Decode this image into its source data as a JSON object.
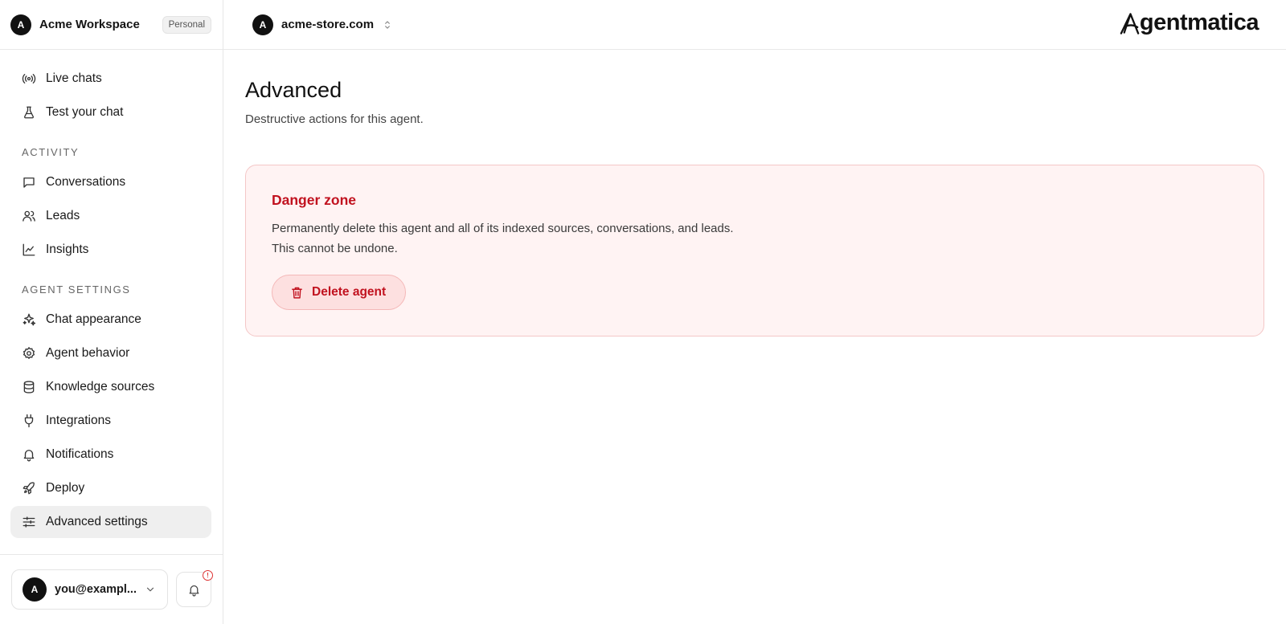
{
  "workspace": {
    "avatar_letter": "A",
    "name": "Acme Workspace",
    "badge": "Personal"
  },
  "nav": {
    "top_items": [
      {
        "label": "Live chats",
        "icon": "broadcast-icon"
      },
      {
        "label": "Test your chat",
        "icon": "flask-icon"
      }
    ],
    "sections": [
      {
        "title": "ACTIVITY",
        "items": [
          {
            "label": "Conversations",
            "icon": "message-square-icon"
          },
          {
            "label": "Leads",
            "icon": "users-icon"
          },
          {
            "label": "Insights",
            "icon": "line-chart-icon"
          }
        ]
      },
      {
        "title": "AGENT SETTINGS",
        "items": [
          {
            "label": "Chat appearance",
            "icon": "sparkles-icon"
          },
          {
            "label": "Agent behavior",
            "icon": "gear-icon"
          },
          {
            "label": "Knowledge sources",
            "icon": "database-icon"
          },
          {
            "label": "Integrations",
            "icon": "plug-icon"
          },
          {
            "label": "Notifications",
            "icon": "bell-icon"
          },
          {
            "label": "Deploy",
            "icon": "rocket-icon"
          },
          {
            "label": "Advanced settings",
            "icon": "sliders-icon",
            "active": true
          }
        ]
      }
    ]
  },
  "footer": {
    "avatar_letter": "A",
    "user_email": "you@exampl...",
    "alert_glyph": "!"
  },
  "topbar": {
    "site_avatar_letter": "A",
    "site_name": "acme-store.com",
    "logo_text": "gentmatica"
  },
  "main": {
    "title": "Advanced",
    "description": "Destructive actions for this agent.",
    "danger_zone": {
      "title": "Danger zone",
      "line1": "Permanently delete this agent and all of its indexed sources, conversations, and leads.",
      "line2": "This cannot be undone.",
      "button_label": "Delete agent"
    }
  },
  "colors": {
    "danger": "#c1121f",
    "danger_bg": "#fff3f3",
    "danger_border": "#f4c7c7",
    "active_bg": "#efefef"
  }
}
